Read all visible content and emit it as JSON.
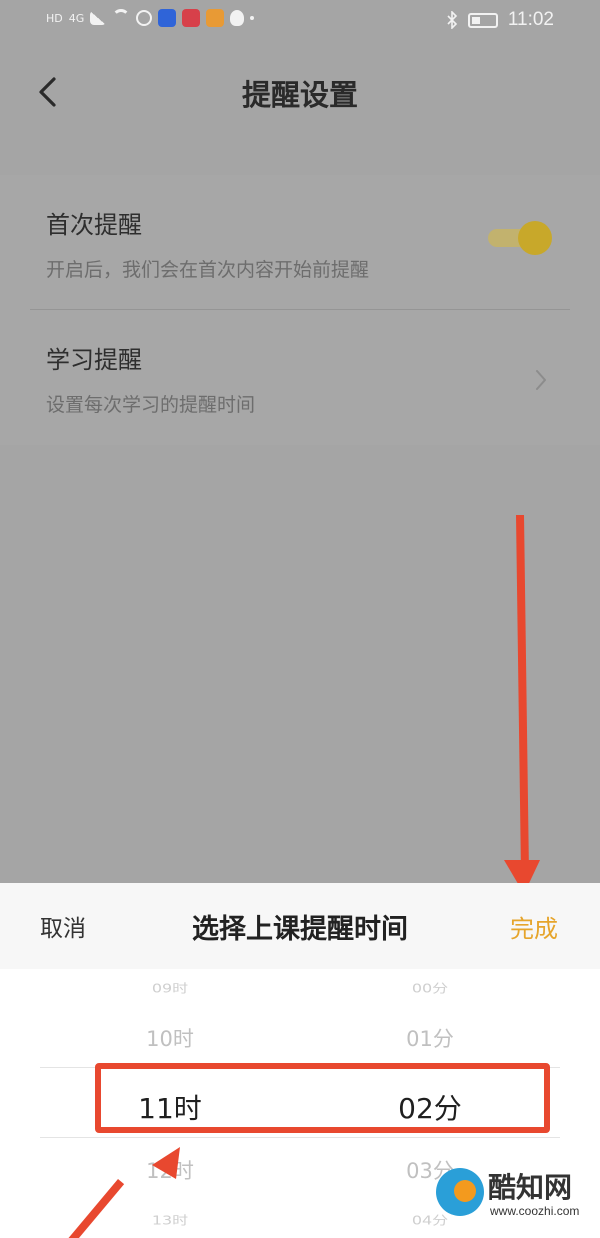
{
  "status_bar": {
    "left_label": "HD",
    "network": "4G",
    "time": "11:02"
  },
  "header": {
    "title": "提醒设置"
  },
  "settings": [
    {
      "title": "首次提醒",
      "subtitle": "开启后，我们会在首次内容开始前提醒",
      "control": "toggle",
      "enabled": true
    },
    {
      "title": "学习提醒",
      "subtitle": "设置每次学习的提醒时间",
      "control": "chevron"
    }
  ],
  "sheet": {
    "cancel_label": "取消",
    "title": "选择上课提醒时间",
    "done_label": "完成"
  },
  "picker": {
    "hours": [
      "09时",
      "10时",
      "11时",
      "12时",
      "13时"
    ],
    "minutes": [
      "00分",
      "01分",
      "02分",
      "03分",
      "04分"
    ],
    "selected_hour": "11时",
    "selected_minute": "02分"
  },
  "annotation": {
    "color": "#e8482f"
  },
  "watermark": {
    "name": "酷知网",
    "url": "www.coozhi.com"
  },
  "colors": {
    "accent": "#e6a52c",
    "overlay": "#a5a5a5"
  }
}
